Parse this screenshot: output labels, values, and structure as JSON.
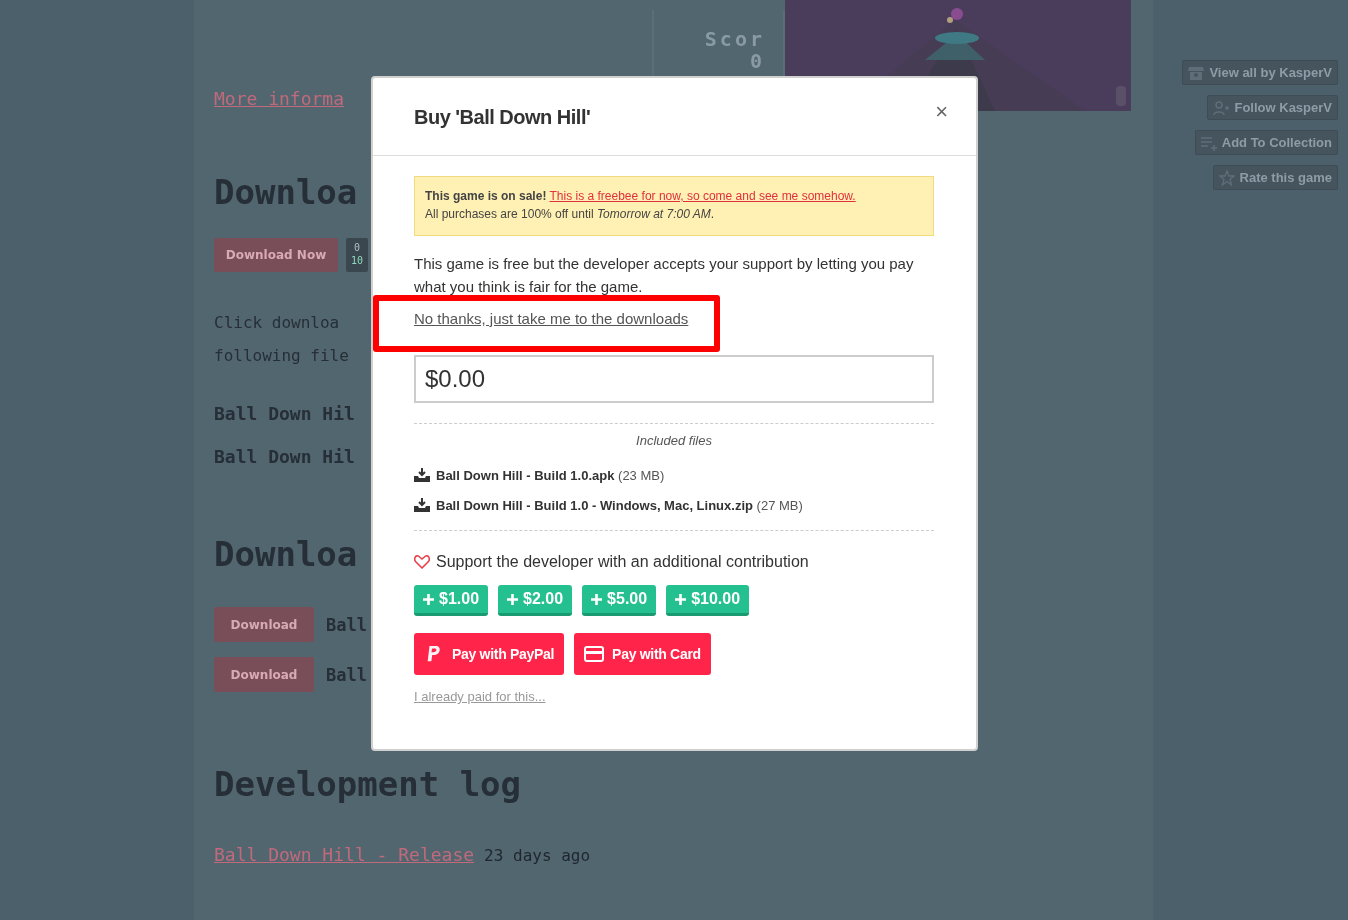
{
  "background_page": {
    "game_frame": {
      "score_label": "Scor",
      "score_value": "0"
    },
    "more_info_link": "More informa",
    "downloads_heading": "Downloa",
    "download_now_button": "Download Now",
    "price_widget": {
      "line_1": "0",
      "line_2": "10"
    },
    "instructions": [
      "Click downloa",
      "following file"
    ],
    "files": [
      "Ball Down Hil",
      "Ball Down Hil"
    ],
    "downloads_heading_2": "Downloa",
    "download_rows": [
      {
        "button": "Download",
        "name": "Ball"
      },
      {
        "button": "Download",
        "name": "Ball"
      }
    ],
    "devlog_heading": "Development log",
    "devlog_entry": {
      "title": "Ball Down Hill - Release",
      "age": "23 days ago"
    }
  },
  "sidebar_buttons": [
    {
      "kind": "store",
      "label": "View all by KasperV"
    },
    {
      "kind": "follow",
      "label": "Follow KasperV"
    },
    {
      "kind": "collection",
      "label": "Add To Collection"
    },
    {
      "kind": "rate",
      "label": "Rate this game"
    }
  ],
  "modal": {
    "title": "Buy 'Ball Down Hill'",
    "close": "×",
    "sale_notice": {
      "label": "This game is on sale!",
      "link": "This is a freebee for now, so come and see me somehow.",
      "detail": "All purchases are 100% off until *Tomorrow at 7:00 AM*."
    },
    "description": "This game is free but the developer accepts your support by letting you pay what you think is fair for the game.",
    "skip_link": "No thanks, just take me to the downloads",
    "price_field": {
      "value": "$0.00"
    },
    "included_files_heading": "Included files",
    "included_files": [
      {
        "name": "Ball Down Hill - Build 1.0.apk",
        "size": "(23 MB)"
      },
      {
        "name": "Ball Down Hill - Build 1.0 - Windows, Mac, Linux.zip",
        "size": "(27 MB)"
      }
    ],
    "support_text": "Support the developer with an additional contribution",
    "tip_buttons": [
      "$1.00",
      "$2.00",
      "$5.00",
      "$10.00"
    ],
    "pay_buttons": [
      {
        "kind": "paypal",
        "label": "Pay with PayPal"
      },
      {
        "kind": "card",
        "label": "Pay with Card"
      }
    ],
    "already_paid_link": "I already paid for this..."
  }
}
